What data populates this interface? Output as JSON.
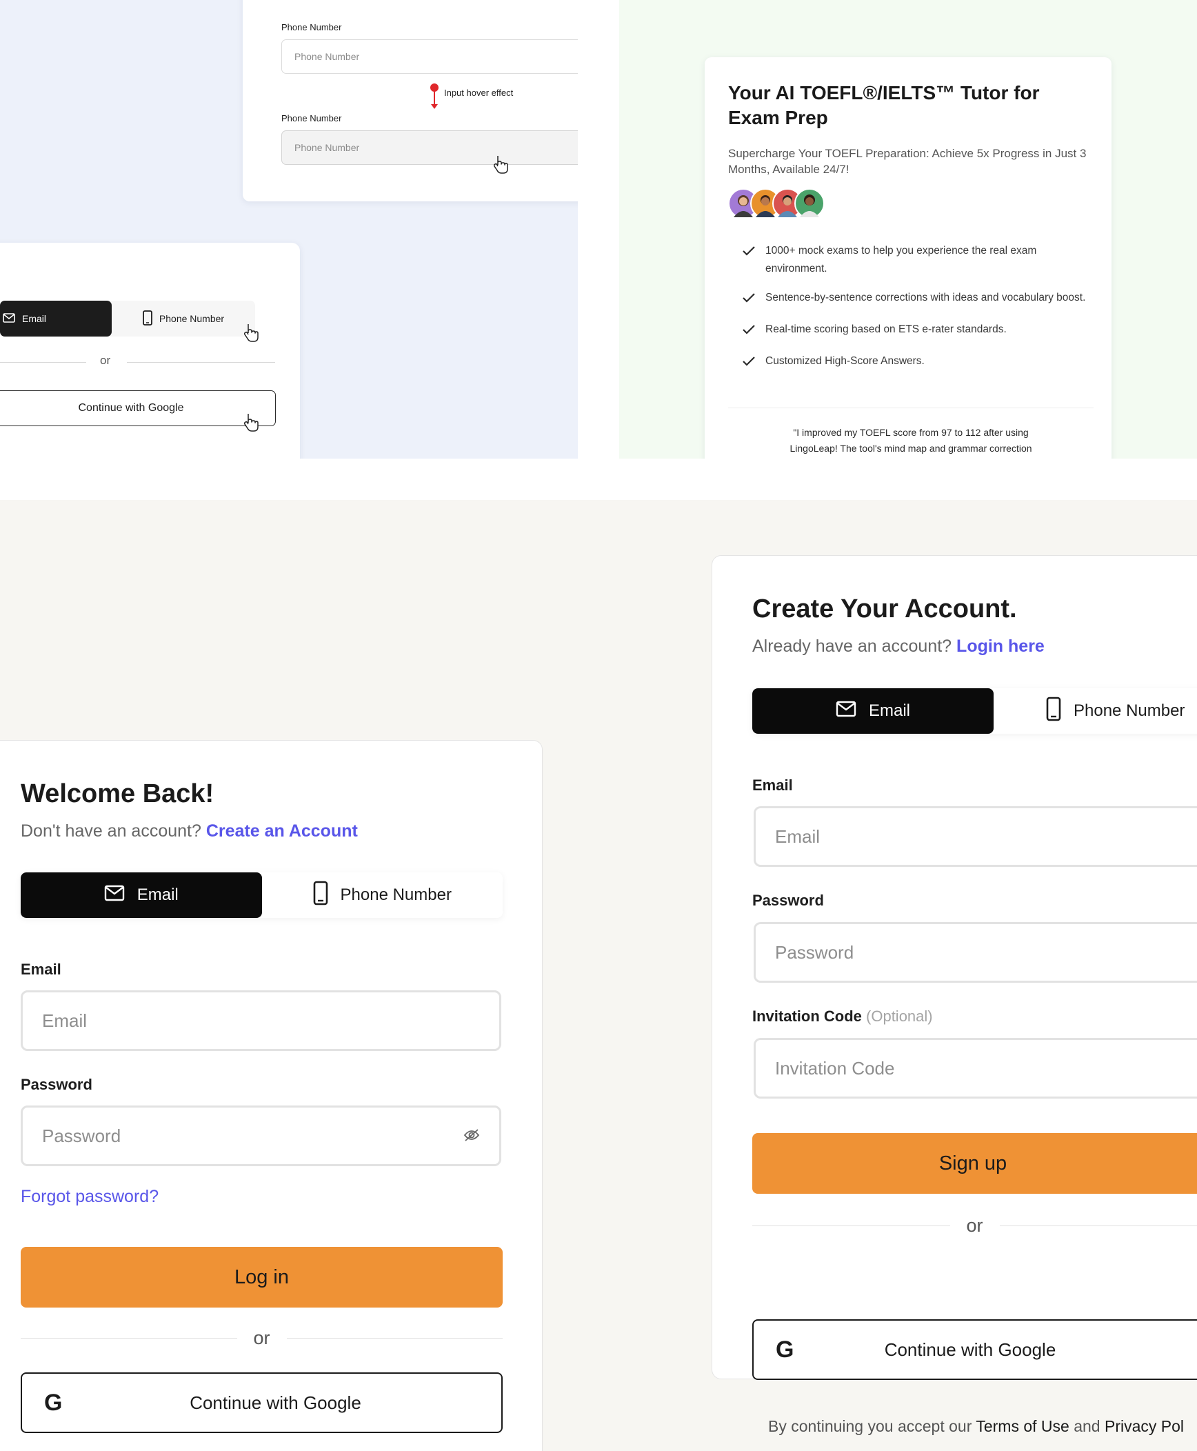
{
  "hover_demo": {
    "label1": "Phone Number",
    "placeholder1": "Phone Number",
    "annotation": "Input hover effect",
    "label2": "Phone Number",
    "placeholder2": "Phone Number"
  },
  "mini_auth": {
    "tab_email": "Email",
    "tab_phone": "Phone Number",
    "or": "or",
    "google": "Continue with Google"
  },
  "promo": {
    "title": "Your AI TOEFL®/IELTS™ Tutor for Exam Prep",
    "subtitle": "Supercharge Your TOEFL Preparation: Achieve 5x Progress in Just 3 Months, Available 24/7!",
    "features": [
      "1000+ mock exams to help you experience the real exam environment.",
      "Sentence-by-sentence corrections with ideas and vocabulary boost.",
      "Real-time scoring based on ETS e-rater standards.",
      "Customized High-Score Answers."
    ],
    "quote_line1": "\"I improved my TOEFL score from 97 to 112 after using",
    "quote_line2": "LingoLeap! The tool's mind map and grammar correction"
  },
  "login": {
    "title": "Welcome Back!",
    "prompt": "Don't have an account?",
    "link": "Create an Account",
    "tab_email": "Email",
    "tab_phone": "Phone Number",
    "email_label": "Email",
    "email_placeholder": "Email",
    "password_label": "Password",
    "password_placeholder": "Password",
    "forgot": "Forgot password?",
    "submit": "Log in",
    "or": "or",
    "google": "Continue with Google"
  },
  "signup": {
    "title": "Create Your Account.",
    "prompt": "Already have an account?",
    "link": "Login here",
    "tab_email": "Email",
    "tab_phone": "Phone Number",
    "email_label": "Email",
    "email_placeholder": "Email",
    "password_label": "Password",
    "password_placeholder": "Password",
    "invite_label": "Invitation Code",
    "invite_optional": "(Optional)",
    "invite_placeholder": "Invitation Code",
    "submit": "Sign up",
    "or": "or",
    "google": "Continue with Google"
  },
  "legal": {
    "prefix": "By continuing you accept our",
    "terms": "Terms of Use",
    "and": "and",
    "privacy": "Privacy Pol"
  },
  "colors": {
    "accent_orange": "#ef9235",
    "link_purple": "#5956e9",
    "annotation_red": "#e0272b"
  },
  "icons": [
    "mail-icon",
    "phone-icon",
    "pointer-hand-icon",
    "pin-icon",
    "check-icon",
    "eye-off-icon",
    "google-icon"
  ]
}
